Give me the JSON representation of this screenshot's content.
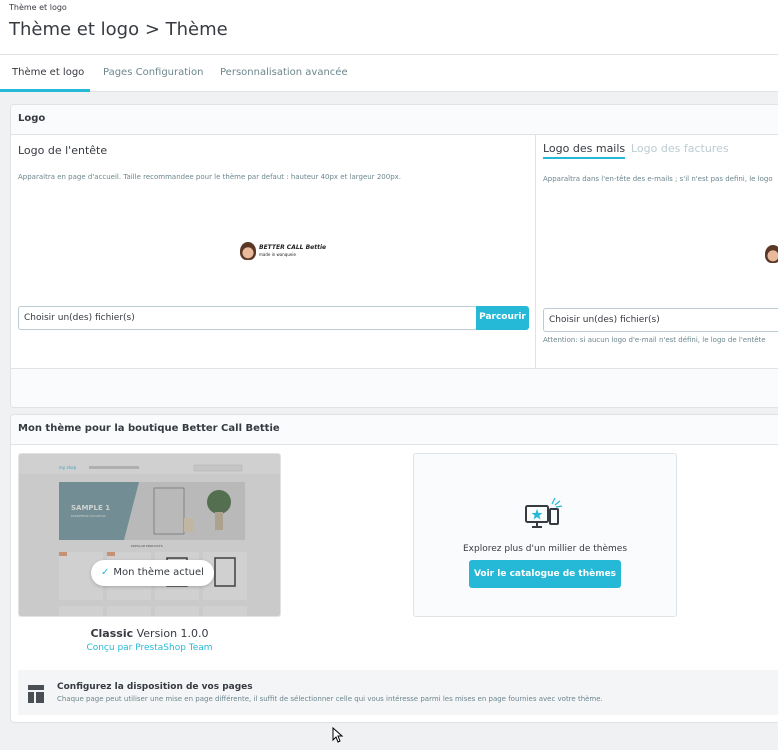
{
  "header": {
    "breadcrumb": "Thème et logo",
    "title": "Thème et logo > Thème"
  },
  "tabs": [
    {
      "label": "Thème et logo",
      "active": true
    },
    {
      "label": "Pages Configuration",
      "active": false
    },
    {
      "label": "Personnalisation avancée",
      "active": false
    }
  ],
  "logo_panel": {
    "heading": "Logo",
    "header_logo": {
      "title": "Logo de l'entête",
      "help": "Apparaitra en page d'accueil. Taille recommandee pour le thème par defaut : hauteur 40px et largeur 200px.",
      "file_placeholder": "Choisir un(des) fichier(s)",
      "browse_label": "Parcourir",
      "logo_text": "BETTER CALL Bettie",
      "logo_tagline": "made in wanqueie"
    },
    "mail_logo": {
      "tab_mail": "Logo des mails",
      "tab_invoice": "Logo des factures",
      "help": "Apparaîtra dans l'en-tête des e-mails ; s'il n'est pas defini, le logo",
      "file_placeholder": "Choisir un(des) fichier(s)",
      "warning": "Attention: si aucun logo d'e-mail n'est défini, le logo de l'entête"
    }
  },
  "theme_panel": {
    "heading": "Mon thème pour la boutique Better Call Bettie",
    "current_badge": "Mon thème actuel",
    "theme_name": "Classic",
    "theme_version": "Version 1.0.0",
    "theme_author": "Conçu par PrestaShop Team",
    "thumb": {
      "shop_name": "my shop",
      "slide_title": "SAMPLE 1",
      "slide_sub": "EXCEPTEUR OCCAECAT",
      "popular": "POPULAR PRODUCTS"
    },
    "catalog_text": "Explorez plus d'un millier de thèmes",
    "catalog_button": "Voir le catalogue de thèmes",
    "layout_title": "Configurez la disposition de vos pages",
    "layout_desc": "Chaque page peut utiliser une mise en page différente, il suffit de sélectionner celle qui vous intéresse parmi les mises en page fournies avec votre thème."
  },
  "colors": {
    "accent": "#25b9d7",
    "text": "#363a41",
    "muted": "#6c868e",
    "background": "#eff1f2"
  }
}
